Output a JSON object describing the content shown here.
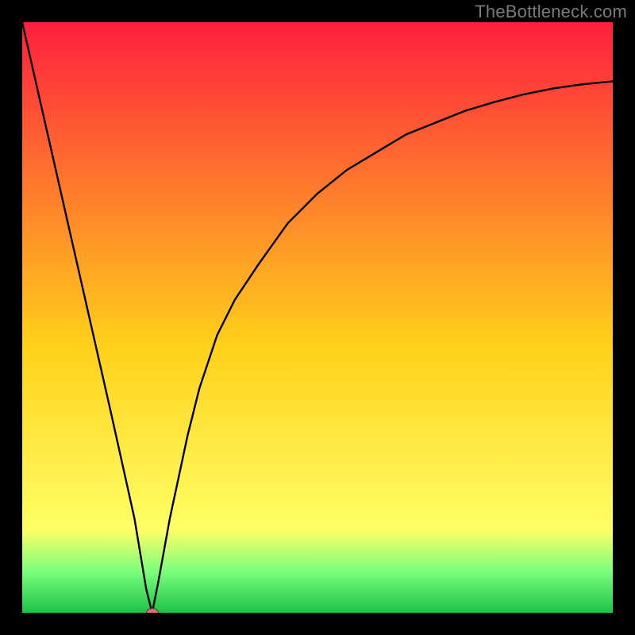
{
  "watermark": "TheBottleneck.com",
  "colors": {
    "top": "#ff1f3f",
    "mid": "#ffd11a",
    "low": "#ffff66",
    "bottom_band": "#7cff7c",
    "bottom_line": "#1cc24a",
    "curve": "#000000",
    "marker": "#d8746e",
    "frame": "#000000"
  },
  "chart_data": {
    "type": "line",
    "title": "",
    "xlabel": "",
    "ylabel": "",
    "xlim": [
      0,
      100
    ],
    "ylim": [
      0,
      100
    ],
    "x": [
      0,
      5,
      10,
      15,
      17,
      19,
      20,
      21,
      22,
      23,
      25,
      28,
      30,
      33,
      36,
      40,
      45,
      50,
      55,
      60,
      65,
      70,
      75,
      80,
      85,
      90,
      95,
      100
    ],
    "values": [
      100,
      78,
      56,
      34,
      25,
      16,
      10,
      4,
      0,
      5,
      16,
      30,
      38,
      47,
      53,
      59,
      66,
      71,
      75,
      78,
      81,
      83,
      85,
      86.5,
      87.8,
      88.8,
      89.5,
      90
    ],
    "minimum_x": 22,
    "minimum_y": 0,
    "marker": {
      "x": 22,
      "y": 0
    },
    "gradient_stops": [
      {
        "pos": 0.0,
        "key": "top"
      },
      {
        "pos": 0.55,
        "key": "mid"
      },
      {
        "pos": 0.86,
        "key": "low"
      },
      {
        "pos": 0.93,
        "key": "bottom_band"
      },
      {
        "pos": 1.0,
        "key": "bottom_line"
      }
    ]
  }
}
